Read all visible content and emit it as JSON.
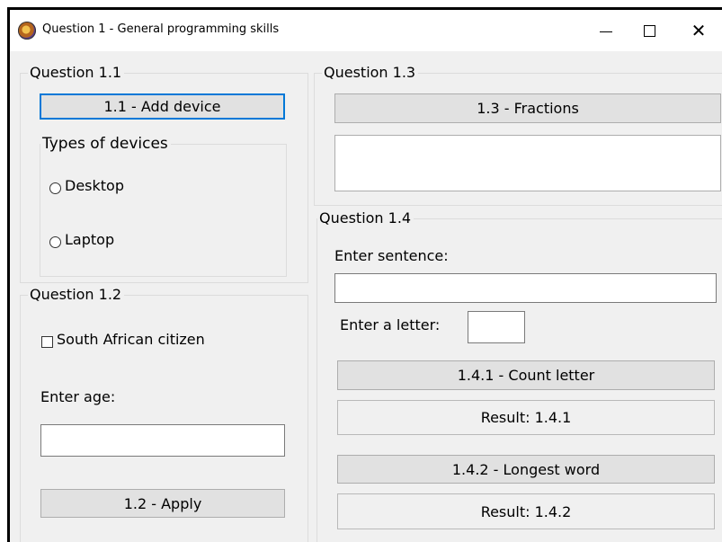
{
  "window": {
    "title": "Question 1 - General programming skills",
    "icon": "app-icon",
    "controls": {
      "minimize": "minimize-icon",
      "maximize": "maximize-icon",
      "close": "close-icon"
    }
  },
  "q11": {
    "label": "Question 1.1",
    "add_button": "1.1 - Add device",
    "types": {
      "label": "Types of devices",
      "options": [
        "Desktop",
        "Laptop"
      ]
    }
  },
  "q12": {
    "label": "Question 1.2",
    "checkbox_label": "South African citizen",
    "age_label": "Enter age:",
    "age_value": "",
    "apply_button": "1.2 - Apply"
  },
  "q13": {
    "label": "Question 1.3",
    "fractions_button": "1.3 - Fractions",
    "output_value": ""
  },
  "q14": {
    "label": "Question 1.4",
    "sentence_label": "Enter sentence:",
    "sentence_value": "",
    "letter_label": "Enter a letter:",
    "letter_value": "",
    "count_button": "1.4.1 - Count letter",
    "result1": "Result: 1.4.1",
    "longest_button": "1.4.2 - Longest word",
    "result2": "Result: 1.4.2"
  },
  "colors": {
    "focus": "#0078d7",
    "button_bg": "#e1e1e1",
    "window_bg": "#f0f0f0"
  }
}
